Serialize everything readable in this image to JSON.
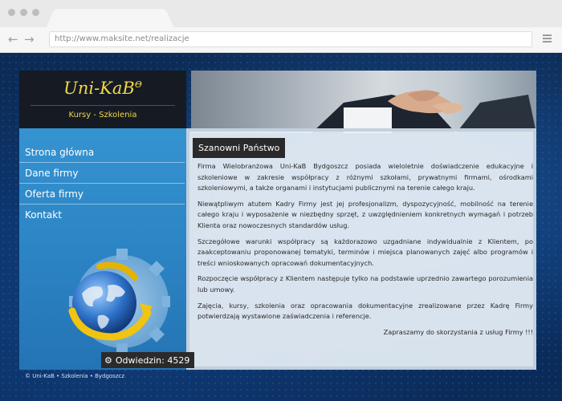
{
  "browser": {
    "url": "http://www.maksite.net/realizacje"
  },
  "brand": {
    "title": "Uni-KaB",
    "title_mark": "Θ",
    "subtitle": "Kursy - Szkolenia"
  },
  "nav": {
    "items": [
      {
        "label": "Strona główna"
      },
      {
        "label": "Dane firmy"
      },
      {
        "label": "Oferta firmy"
      },
      {
        "label": "Kontakt"
      }
    ]
  },
  "visits": {
    "label": "Odwiedzin: 4529"
  },
  "footer": {
    "note": "© Uni-KaB • Szkolenia • Bydgoszcz"
  },
  "content": {
    "title": "Szanowni Państwo",
    "paragraphs": [
      "Firma Wielobranżowa Uni-KaB Bydgoszcz posiada wieloletnie doświadczenie edukacyjne i szkoleniowe w zakresie współpracy z różnymi szkołami, prywatnymi firmami, ośrodkami szkoleniowymi, a także organami i instytucjami publicznymi na terenie całego kraju.",
      "Niewątpliwym atutem Kadry Firmy jest jej profesjonalizm, dyspozycyjność, mobilność na terenie całego kraju i wyposażenie w niezbędny sprzęt, z uwzględnieniem konkretnych wymagań i potrzeb Klienta oraz nowoczesnych standardów usług.",
      "Szczegółowe warunki współpracy są każdorazowo uzgadniane indywidualnie z Klientem, po zaakceptowaniu proponowanej tematyki, terminów i miejsca planowanych zajęć albo programów i treści wnioskowanych opracowań dokumentacyjnych.",
      "Rozpoczęcie współpracy z Klientem następuje tylko na podstawie uprzednio zawartego porozumienia lub umowy.",
      "Zajęcia, kursy, szkolenia oraz opracowania dokumentacyjne zrealizowane przez Kadrę Firmy potwierdzają wystawione zaświadczenia i referencje."
    ],
    "closing": "Zapraszamy do skorzystania z usług Firmy !!!"
  }
}
